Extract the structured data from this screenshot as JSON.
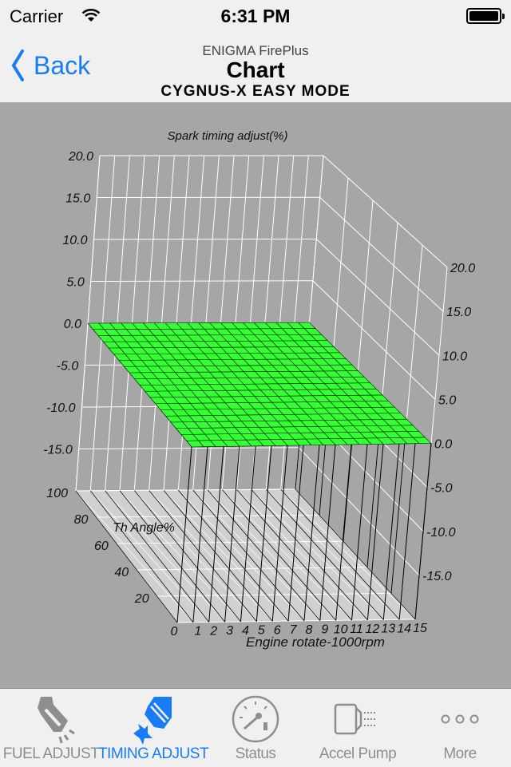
{
  "status_bar": {
    "carrier": "Carrier",
    "time": "6:31 PM",
    "battery_level": 1.0
  },
  "nav": {
    "back_label": "Back",
    "app_name": "ENIGMA FirePlus",
    "title": "Chart",
    "subtitle": "CYGNUS-X EASY MODE"
  },
  "colors": {
    "accent": "#1a7cf5",
    "surface": "#33ff33",
    "background": "#a6a6a6",
    "floor": "#d0d0d0"
  },
  "chart_data": {
    "type": "surface3d",
    "zlabel": "Spark timing adjust(%)",
    "ylabel": "Th Angle%",
    "xlabel": "Engine rotate-1000rpm",
    "x_ticks": [
      "0",
      "1",
      "2",
      "3",
      "4",
      "5",
      "6",
      "7",
      "8",
      "9",
      "10",
      "11",
      "12",
      "13",
      "14",
      "15"
    ],
    "y_ticks": [
      "20",
      "40",
      "60",
      "80",
      "100"
    ],
    "z_ticks": [
      "20.0",
      "15.0",
      "10.0",
      "5.0",
      "0.0",
      "-5.0",
      "-10.0",
      "-15.0"
    ],
    "xlim": [
      0,
      15
    ],
    "ylim": [
      0,
      100
    ],
    "zlim": [
      -20,
      20
    ],
    "surface_value": 0.0,
    "grid": true
  },
  "tabs": [
    {
      "label": "FUEL ADJUST",
      "icon": "fuel-injector-icon",
      "active": false
    },
    {
      "label": "TIMING ADJUST",
      "icon": "spark-plug-icon",
      "active": true
    },
    {
      "label": "Status",
      "icon": "gauge-icon",
      "active": false
    },
    {
      "label": "Accel Pump",
      "icon": "accel-pump-icon",
      "active": false
    },
    {
      "label": "More",
      "icon": "more-icon",
      "active": false
    }
  ]
}
